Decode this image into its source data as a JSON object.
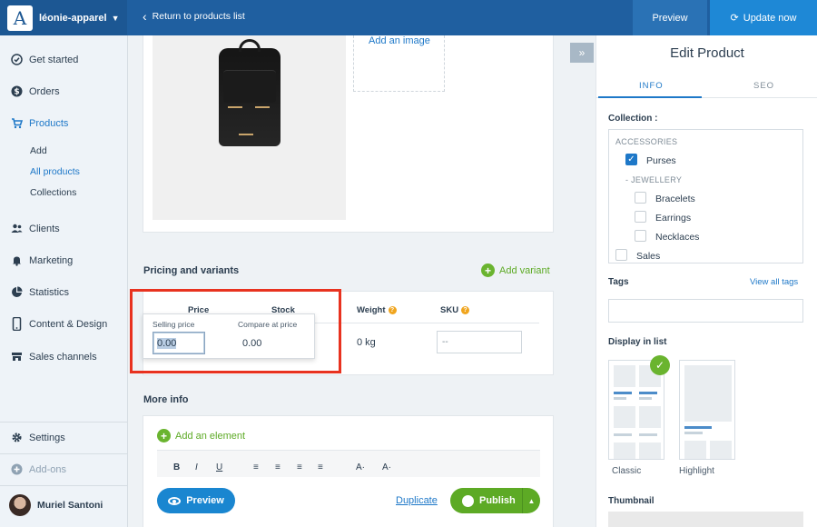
{
  "topbar": {
    "logo_letter": "A",
    "store_name": "léonie-apparel",
    "back_label": "Return to products list",
    "preview_label": "Preview",
    "update_label": "Update now"
  },
  "sidebar": {
    "items": [
      {
        "label": "Get started",
        "icon": "check-circle-icon"
      },
      {
        "label": "Orders",
        "icon": "dollar-icon"
      },
      {
        "label": "Products",
        "icon": "cart-icon"
      },
      {
        "label": "Clients",
        "icon": "users-icon"
      },
      {
        "label": "Marketing",
        "icon": "bell-icon"
      },
      {
        "label": "Statistics",
        "icon": "pie-chart-icon"
      },
      {
        "label": "Content & Design",
        "icon": "phone-icon"
      },
      {
        "label": "Sales channels",
        "icon": "store-icon"
      }
    ],
    "products_sub": [
      "Add",
      "All products",
      "Collections"
    ],
    "settings_label": "Settings",
    "addons_label": "Add-ons",
    "user_name": "Muriel Santoni"
  },
  "main": {
    "add_image_label": "Add an image",
    "pricing_title": "Pricing and variants",
    "add_variant_label": "Add variant",
    "columns": {
      "price": "Price",
      "stock": "Stock",
      "weight": "Weight",
      "sku": "SKU"
    },
    "popover": {
      "selling_label": "Selling price",
      "selling_value": "0.00",
      "compare_label": "Compare at price",
      "compare_value": "0.00"
    },
    "weight_value": "0 kg",
    "sku_placeholder": "--",
    "more_info_title": "More info",
    "add_element_label": "Add an element",
    "toolbar": [
      "B",
      "I",
      "U",
      "≡",
      "≡",
      "≡",
      "≡",
      "A·",
      "A·"
    ],
    "preview_btn": "Preview",
    "duplicate_label": "Duplicate",
    "publish_label": "Publish"
  },
  "panel": {
    "title": "Edit Product",
    "tabs": [
      "INFO",
      "SEO"
    ],
    "collection_label": "Collection :",
    "collections": {
      "group1": "ACCESSORIES",
      "purses": "Purses",
      "group2": "- JEWELLERY",
      "bracelets": "Bracelets",
      "earrings": "Earrings",
      "necklaces": "Necklaces",
      "sales": "Sales"
    },
    "tags_label": "Tags",
    "view_all_tags": "View all tags",
    "display_label": "Display in list",
    "display_options": [
      "Classic",
      "Highlight"
    ],
    "display_selected": "Classic",
    "thumbnail_label": "Thumbnail"
  },
  "colors": {
    "topbar": "#1f5fa0",
    "accent_blue": "#1e78c8",
    "green": "#5daa25",
    "highlight_red": "#e8321f"
  }
}
